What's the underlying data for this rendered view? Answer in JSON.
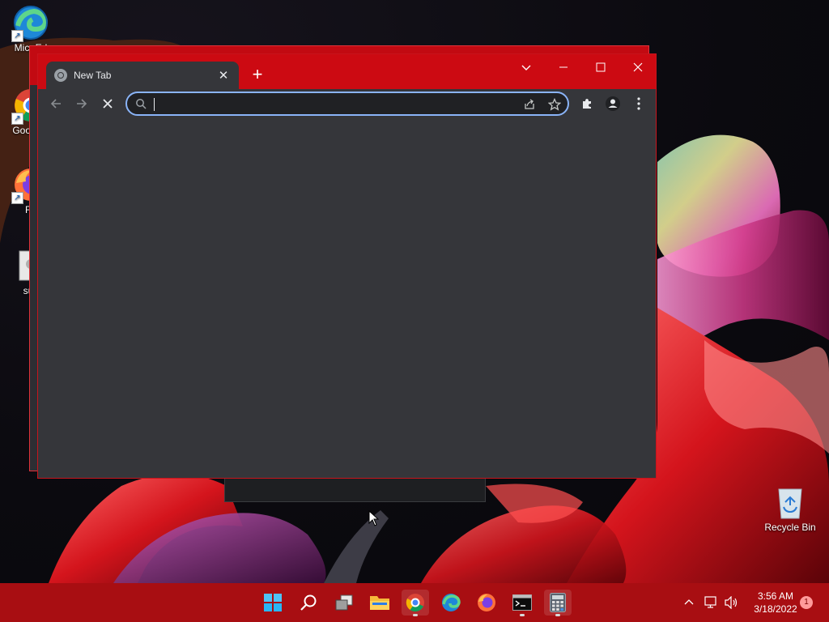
{
  "desktop": {
    "icons": [
      {
        "label": "Micr Ed"
      },
      {
        "label": "Goo Chr"
      },
      {
        "label": "Fir"
      },
      {
        "label": "sus"
      }
    ],
    "recycle_bin": {
      "label": "Recycle Bin"
    }
  },
  "browser": {
    "tab": {
      "title": "New Tab",
      "close_glyph": "✕"
    },
    "new_tab_glyph": "+",
    "caption": {
      "dropdown": "⌄",
      "minimize": "—",
      "maximize": "☐",
      "close": "✕"
    },
    "nav": {
      "back": "←",
      "forward": "→",
      "stop": "✕"
    },
    "omnibox": {
      "value": "",
      "placeholder": ""
    },
    "toolbar_icons": [
      "share-icon",
      "star-icon",
      "puzzle-icon",
      "profile-icon",
      "menu-icon"
    ]
  },
  "taskbar": {
    "apps": [
      "start",
      "search",
      "task-view",
      "file-explorer",
      "chrome",
      "edge",
      "firefox",
      "terminal",
      "calculator"
    ],
    "clock": {
      "time": "3:56 AM",
      "date": "3/18/2022"
    },
    "notification_count": "1"
  },
  "colors": {
    "accent": "#cc0a12",
    "taskbar": "#a80e12",
    "omnibox_focus": "#8ab4f8"
  }
}
